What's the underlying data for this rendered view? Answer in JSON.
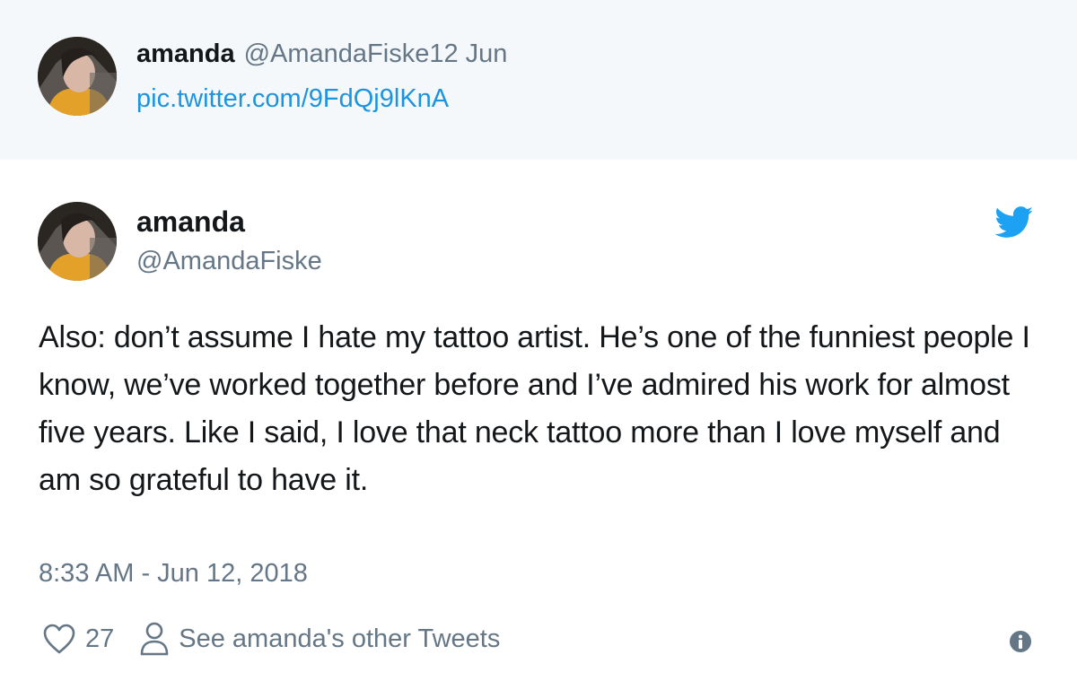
{
  "quoted_tweet": {
    "name": "amanda",
    "handle": "@AmandaFiske",
    "date": "12 Jun",
    "link": "pic.twitter.com/9FdQj9lKnA",
    "avatar_icon": "profile-photo"
  },
  "main_tweet": {
    "name": "amanda",
    "handle": "@AmandaFiske",
    "avatar_icon": "profile-photo",
    "brand_icon": "twitter-bird-icon",
    "text": "Also: don’t assume I hate my tattoo artist. He’s one of the funniest people I know, we’ve worked together before and I’ve admired his work for almost five years. Like I said, I love that neck tattoo more than I love myself and am so grateful to have it.",
    "timestamp": "8:33 AM - Jun 12, 2018"
  },
  "actions": {
    "like_icon": "heart-icon",
    "like_count": "27",
    "profile_icon": "person-icon",
    "see_other_label": "See amanda's other Tweets",
    "info_icon": "info-icon"
  },
  "colors": {
    "link": "#1b95e0",
    "secondary_text": "#657786",
    "primary_text": "#14171a",
    "quoted_background": "#f5f8fa",
    "twitter_blue": "#1da1f2"
  }
}
